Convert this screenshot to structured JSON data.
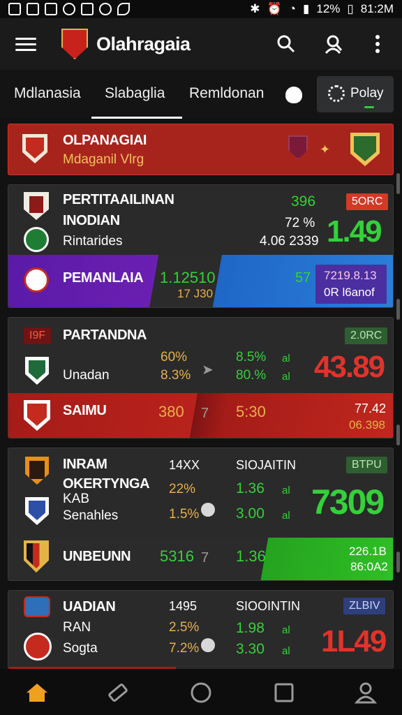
{
  "status_bar": {
    "battery": "12%",
    "time": "81:2M"
  },
  "app": {
    "title": "Olahragaia"
  },
  "tabs": [
    {
      "label": "Mdlanasia"
    },
    {
      "label": "Slabaglia"
    },
    {
      "label": "Remldonan"
    }
  ],
  "play_button": {
    "label": "Polay"
  },
  "banner": {
    "title": "OLPANAGIAI",
    "subtitle": "Mdaganil Vlrg"
  },
  "cards": [
    {
      "rows": [
        {
          "name": "PERTITAAILINAN"
        },
        {
          "name": "INODIAN",
          "pct": "72 %"
        },
        {
          "name": "Rintarides",
          "pct": "4.06 2339"
        }
      ],
      "top_pct": "396",
      "badge": "5ORC",
      "big": "1.49",
      "highlight": {
        "name": "PEMANLAIA",
        "score1": "1.12510",
        "score2": "17 J30",
        "mid": "57",
        "right1": "7219.8.13",
        "right2": "0R l6anof"
      }
    },
    {
      "title": "PARTANDNA",
      "badge": "2.0RC",
      "team": "Unadan",
      "p1": "60%",
      "p2": "8.3%",
      "o1": "8.5%",
      "o2": "80.%",
      "m1": "al",
      "m2": "al",
      "big": "43.89",
      "highlight": {
        "name": "SAIMU",
        "score1": "380",
        "mid": "7",
        "score2": "5:30",
        "right1": "77.42",
        "right2": "06.398"
      }
    },
    {
      "title": "INRAM",
      "sub1": "OKERTYNGA",
      "sub2": "KAB",
      "sub3": "Senahles",
      "col_head": "14XX",
      "p1": "22%",
      "p2": "1.5%",
      "mk_head": "SIOJAITIN",
      "o1": "1.36",
      "o2": "3.00",
      "m1": "al",
      "m2": "al",
      "badge": "BTPU",
      "big": "7309",
      "highlight": {
        "name": "UNBEUNN",
        "score1": "5316",
        "mid": "7",
        "score2": "1.36",
        "right1": "226.1B",
        "right2": "86:0A2"
      }
    },
    {
      "title": "UADIAN",
      "sub1": "RAN",
      "sub2": "Sogta",
      "col_head": "1495",
      "p1": "2.5%",
      "p2": "7.2%",
      "mk_head": "SIOOINTIN",
      "o1": "1.98",
      "o2": "3.30",
      "m1": "al",
      "m2": "al",
      "badge": "ZLBIV",
      "big": "1L49"
    }
  ]
}
